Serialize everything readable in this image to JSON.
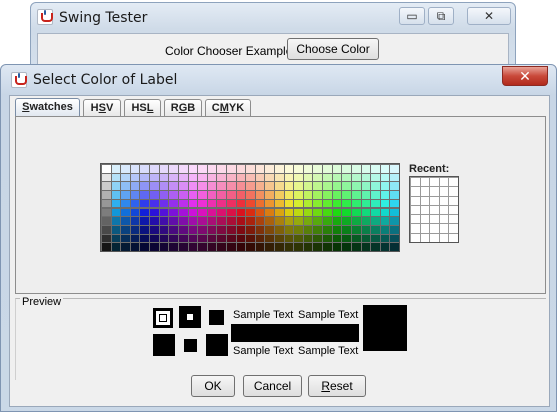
{
  "back_window": {
    "title": "Swing Tester",
    "label": "Color Chooser Example",
    "button": "Choose Color",
    "controls": [
      "▭",
      "⧉",
      "✕"
    ]
  },
  "dialog": {
    "title": "Select Color of Label",
    "close": "✕",
    "tabs": [
      {
        "label": "Swatches",
        "mnemonic_index": 0,
        "active": true
      },
      {
        "label": "HSV",
        "mnemonic_index": 1,
        "active": false
      },
      {
        "label": "HSL",
        "mnemonic_index": 2,
        "active": false
      },
      {
        "label": "RGB",
        "mnemonic_index": 1,
        "active": false
      },
      {
        "label": "CMYK",
        "mnemonic_index": 1,
        "active": false
      }
    ],
    "swatches": {
      "rows": 10,
      "cols": 31
    },
    "recent": {
      "label": "Recent:",
      "rows": 7,
      "cols": 5
    },
    "preview": {
      "label": "Preview",
      "sample_text": "Sample Text",
      "color": "#000000"
    },
    "buttons": {
      "ok": "OK",
      "cancel": "Cancel",
      "reset": "Reset"
    }
  },
  "colors": {
    "title_gradient": "#cfdbe8",
    "close_red": "#c9493a",
    "panel_bg": "#eeeeee"
  }
}
